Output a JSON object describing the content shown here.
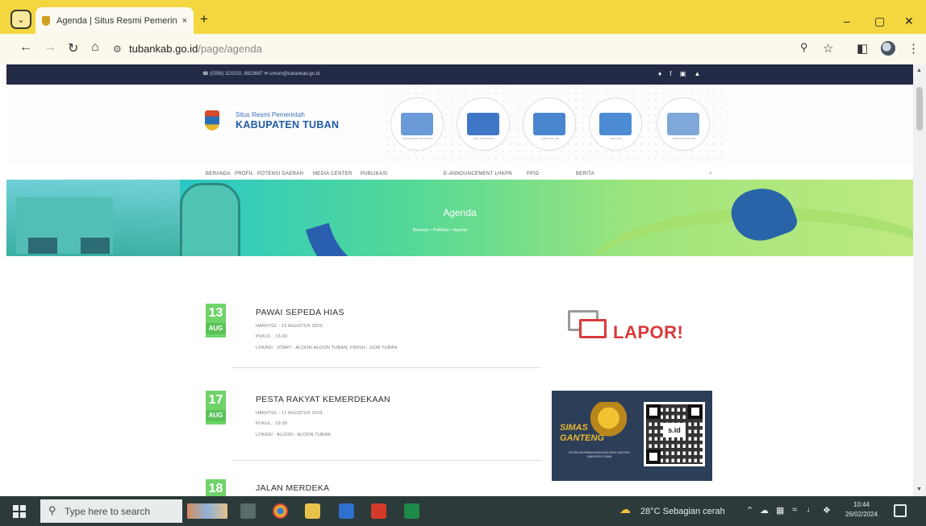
{
  "browser": {
    "tab_title": "Agenda | Situs Resmi Pemerint",
    "tab_close": "×",
    "new_tab": "+",
    "url_domain": "tubankab.go.id",
    "url_path": "/page/agenda",
    "window_controls": {
      "minimize": "–",
      "maximize": "▢",
      "close": "✕"
    },
    "icons": [
      "tab-search-icon",
      "back-icon",
      "forward-icon",
      "reload-icon",
      "home-icon",
      "site-info-icon",
      "zoom-icon",
      "star-icon",
      "sidepanel-icon",
      "profile-icon",
      "menu-icon"
    ]
  },
  "site": {
    "topbar": {
      "contact": "☎ (0356) 321020, 8823697   ✉ umum@tubankab.go.id",
      "social": "♦ f ▣ ▲"
    },
    "logo": {
      "subtitle": "Situs Resmi Pemerintah",
      "title": "KABUPATEN TUBAN"
    },
    "services": [
      {
        "caption": "PENGADUAN PELAYANAN",
        "color": "#6a9ad8"
      },
      {
        "caption": "INFO PELAYANAN",
        "color": "#3f76c6"
      },
      {
        "caption": "SURAT ONLINE",
        "color": "#4a86cf"
      },
      {
        "caption": "WEB MAIL",
        "color": "#4d8bd4"
      },
      {
        "caption": "PERIZINAN ONLINE",
        "color": "#7fa8d8"
      }
    ],
    "nav": [
      "BERANDA",
      "PROFIL",
      "POTENSI DAERAH",
      "MEDIA CENTER",
      "PUBLIKASI",
      "E-ANNOUNCEMENT LHKPN",
      "PPID",
      "BERITA"
    ],
    "nav_search_icon": "⌕",
    "banner": {
      "title": "Agenda",
      "breadcrumb": "Beranda   >   Publikasi   >   Agenda"
    },
    "agenda": [
      {
        "day": "13",
        "month": "AUG",
        "title": "PAWAI SEPEDA HIAS",
        "hari": "HARI/TGL : 13 AGUSTUS 2023",
        "pukul": "PUKUL : 13.00",
        "lokasi": "LOKASI : START : ALOON-ALOON TUBAN, FINISH : GOR TUBAN"
      },
      {
        "day": "17",
        "month": "AUG",
        "title": "PESTA RAKYAT KEMERDEKAAN",
        "hari": "HARI/TGL : 17 AGUSTUS 2023",
        "pukul": "PUKUL : 19.30",
        "lokasi": "LOKASI : ALOON - ALOON TUBAN"
      },
      {
        "day": "18",
        "month": "AUG",
        "title": "JALAN MERDEKA"
      }
    ],
    "lapor": {
      "text": "LAPOR!"
    },
    "simas": {
      "title_line1": "SIMAS",
      "title_line2": "GANTENG",
      "subtitle": "SISTEM INFORMASI ANGKUTAN SIDAS GANTENG KABUPATEN TUBAN",
      "qr_label": "s.id"
    }
  },
  "taskbar": {
    "search_placeholder": "Type here to search",
    "weather": "28°C  Sebagian cerah",
    "clock_time": "10:44",
    "clock_date": "26/02/2024",
    "tray_icons": [
      "⌃",
      "☁",
      "▦",
      "≈",
      "♩",
      "❖"
    ],
    "apps": [
      {
        "name": "task-view",
        "color": "#5a6b6a"
      },
      {
        "name": "chrome",
        "color": "#e7a730"
      },
      {
        "name": "file-explorer",
        "color": "#e9c24a"
      },
      {
        "name": "word",
        "color": "#2f6fcf"
      },
      {
        "name": "pdf",
        "color": "#d43a2a"
      },
      {
        "name": "excel",
        "color": "#1f8a4a"
      }
    ]
  },
  "colors": {
    "titlebar": "#f4d640",
    "site_topbar": "#232a45",
    "logo_blue": "#1f5ba8",
    "date_badge": "#6fd36a",
    "lapor_red": "#d83a3a",
    "taskbar": "#2c3b3a"
  }
}
